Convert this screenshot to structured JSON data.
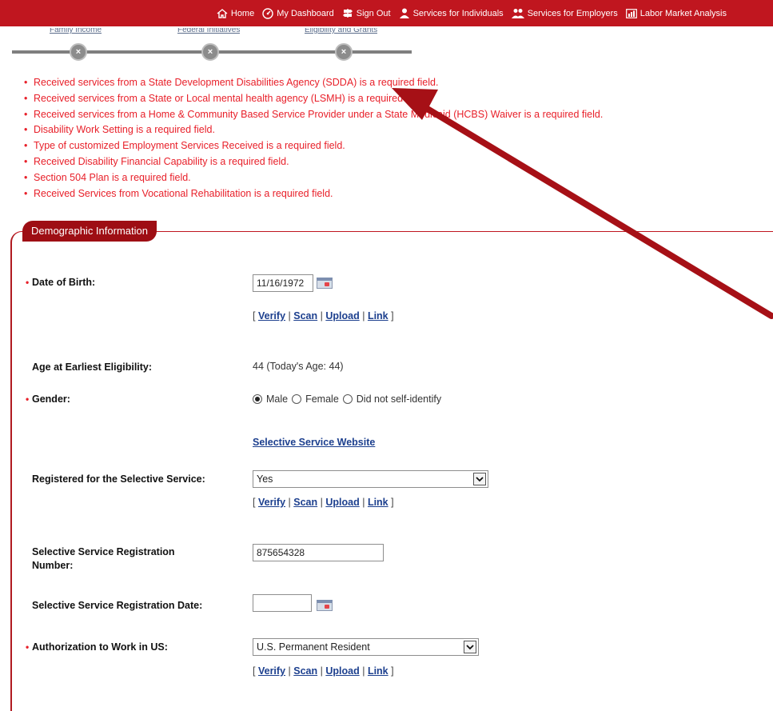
{
  "nav": {
    "items": [
      {
        "label": "Home",
        "icon": "home-icon"
      },
      {
        "label": "My Dashboard",
        "icon": "dashboard-icon"
      },
      {
        "label": "Sign Out",
        "icon": "signpost-icon"
      },
      {
        "label": "Services for Individuals",
        "icon": "person-icon"
      },
      {
        "label": "Services for Employers",
        "icon": "people-icon"
      },
      {
        "label": "Labor Market Analysis",
        "icon": "chart-icon"
      }
    ],
    "bar_color": "#c0161f"
  },
  "steps": [
    {
      "label": "Family Income",
      "status": "x"
    },
    {
      "label": "Federal Initiatives",
      "status": "x"
    },
    {
      "label": "Eligibility and Grants",
      "status": "x"
    }
  ],
  "errors": [
    "Received services from a State Development Disabilities Agency (SDDA) is a required field.",
    "Received services from a State or Local mental health agency (LSMH) is a required field.",
    "Received services from a Home & Community Based Service Provider under a State Medicaid (HCBS) Waiver is a required field.",
    "Disability Work Setting is a required field.",
    "Type of customized Employment Services Received is a required field.",
    "Received Disability Financial Capability is a required field.",
    "Section 504 Plan is a required field.",
    "Received Services from Vocational Rehabilitation is a required field."
  ],
  "section": {
    "title": "Demographic Information"
  },
  "fields": {
    "dob": {
      "label": "Date of Birth:",
      "value": "11/16/1972"
    },
    "age": {
      "label": "Age at Earliest Eligibility:",
      "value": "44 (Today's Age: 44)"
    },
    "gender": {
      "label": "Gender:",
      "options": [
        "Male",
        "Female",
        "Did not self-identify"
      ],
      "selected": "Male"
    },
    "ss_website": "Selective Service Website",
    "ss_registered": {
      "label": "Registered for the Selective Service:",
      "value": "Yes"
    },
    "ss_number": {
      "label": "Selective Service Registration Number:",
      "value": "875654328"
    },
    "ss_date": {
      "label": "Selective Service Registration Date:",
      "value": ""
    },
    "work_auth": {
      "label": "Authorization to Work in US:",
      "value": "U.S. Permanent Resident"
    }
  },
  "doc_links": {
    "verify": "Verify",
    "scan": "Scan",
    "upload": "Upload",
    "link": "Link",
    "open": "[",
    "close": "]",
    "sep": "|"
  },
  "required_marker": "•",
  "step_close_glyph": "×",
  "annotation_arrow_color": "#a61016"
}
